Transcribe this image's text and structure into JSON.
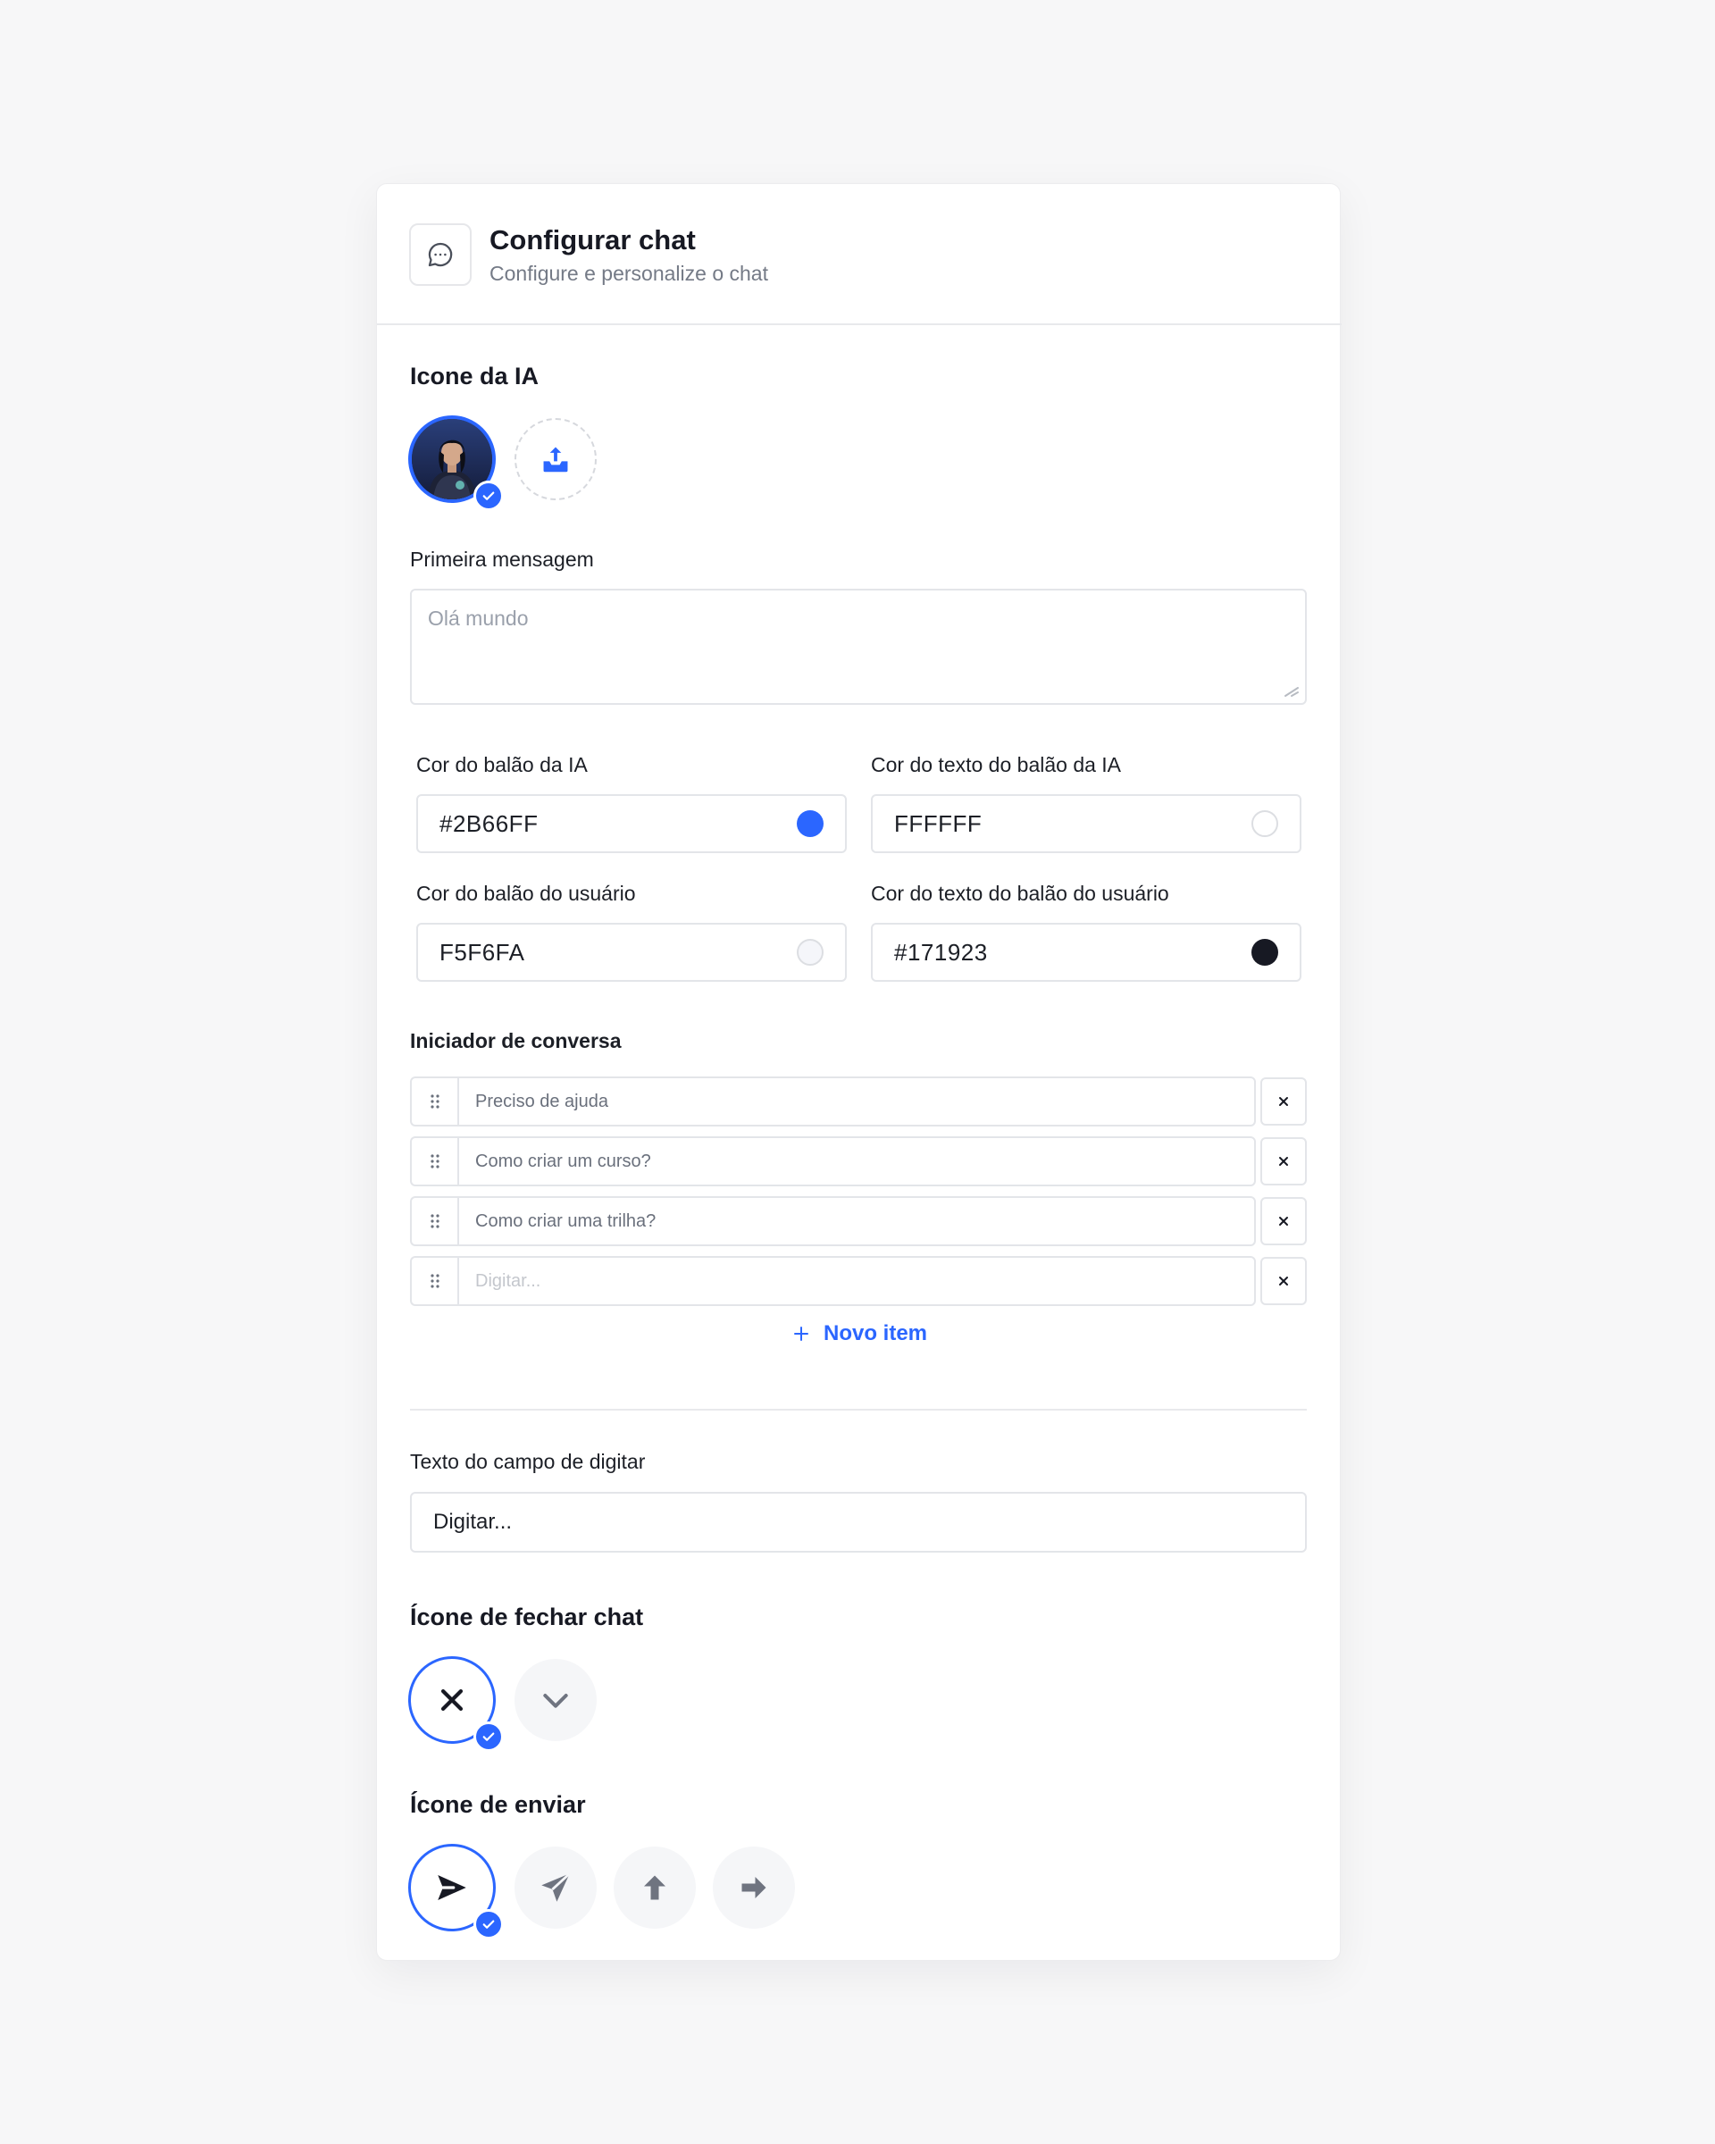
{
  "header": {
    "title": "Configurar chat",
    "subtitle": "Configure e personalize o chat",
    "icon": "chat-bubble-icon"
  },
  "ai_icon": {
    "title": "Icone da IA",
    "selected": "avatar",
    "upload_icon": "upload-icon"
  },
  "first_message": {
    "label": "Primeira mensagem",
    "placeholder": "Olá mundo",
    "value": ""
  },
  "colors": {
    "ai_bubble": {
      "label": "Cor do balão da IA",
      "value": "#2B66FF",
      "swatch": "#2B66FF"
    },
    "ai_text": {
      "label": "Cor do texto do balão da IA",
      "value": "FFFFFF",
      "swatch": "#FFFFFF"
    },
    "user_bubble": {
      "label": "Cor do balão do usuário",
      "value": "F5F6FA",
      "swatch": "#F5F6FA"
    },
    "user_text": {
      "label": "Cor do texto do balão do usuário",
      "value": "#171923",
      "swatch": "#171923"
    }
  },
  "starters": {
    "title": "Iniciador de conversa",
    "items": [
      {
        "value": "Preciso de ajuda"
      },
      {
        "value": "Como criar um curso?"
      },
      {
        "value": "Como criar uma trilha?"
      },
      {
        "value": "",
        "placeholder": "Digitar..."
      }
    ],
    "add_label": "Novo item"
  },
  "input_text": {
    "label": "Texto do campo de digitar",
    "value": "Digitar..."
  },
  "close_icon": {
    "title": "Ícone de fechar chat",
    "options": [
      "close-x-icon",
      "chevron-down-icon"
    ],
    "selected": 0
  },
  "send_icon": {
    "title": "Ícone de enviar",
    "options": [
      "send-arrow-icon",
      "paper-plane-icon",
      "arrow-up-icon",
      "arrow-right-icon"
    ],
    "selected": 0
  },
  "theme": {
    "accent": "#2B66FF",
    "text": "#171923",
    "muted": "#747A86"
  }
}
